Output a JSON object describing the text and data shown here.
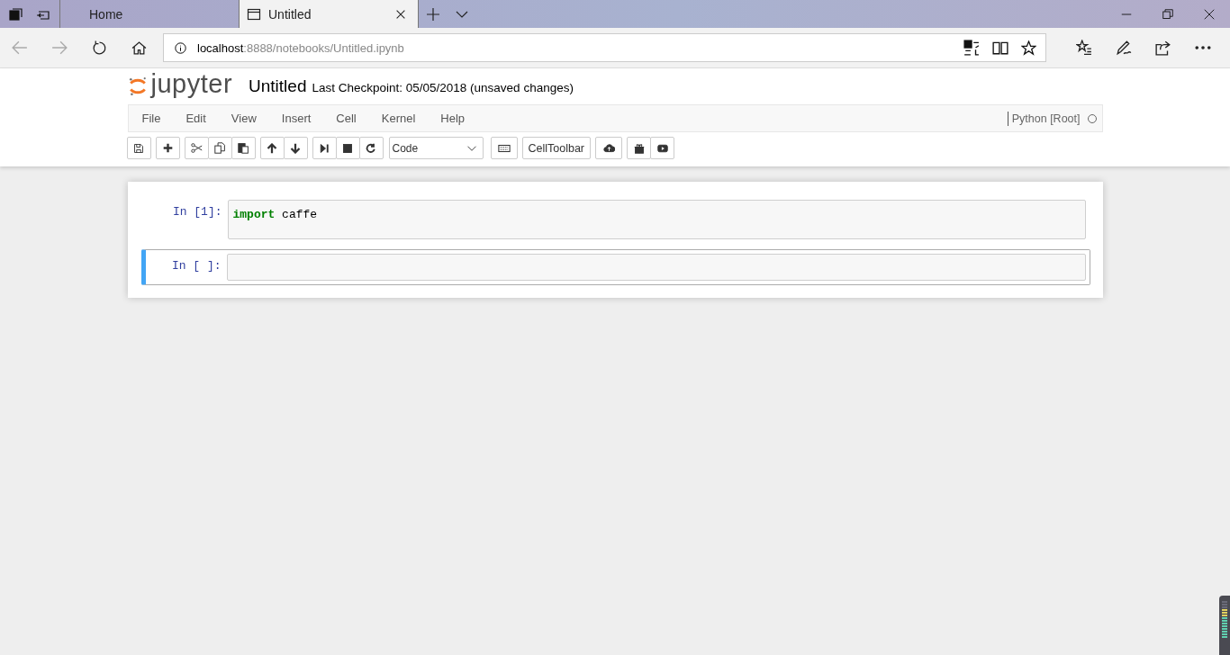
{
  "browser": {
    "tabs": [
      {
        "title": "Home",
        "selected": false
      },
      {
        "title": "Untitled",
        "selected": true
      }
    ],
    "address": "**localhost**:8888/notebooks/Untitled.ipynb"
  },
  "notebook": {
    "logo_text": "jupyter",
    "name": "Untitled",
    "checkpoint": "Last Checkpoint: 05/05/2018 (unsaved changes)",
    "menu": [
      "File",
      "Edit",
      "View",
      "Insert",
      "Cell",
      "Kernel",
      "Help"
    ],
    "kernel": {
      "name": "Python [Root]",
      "busy": false
    },
    "cell_type": "Code",
    "celltoolbar_button": "CellToolbar",
    "cells": [
      {
        "prompt": "In [1]:",
        "code": "**import** caffe",
        "selected": false
      },
      {
        "prompt": "In [ ]:",
        "selected": true
      }
    ]
  }
}
